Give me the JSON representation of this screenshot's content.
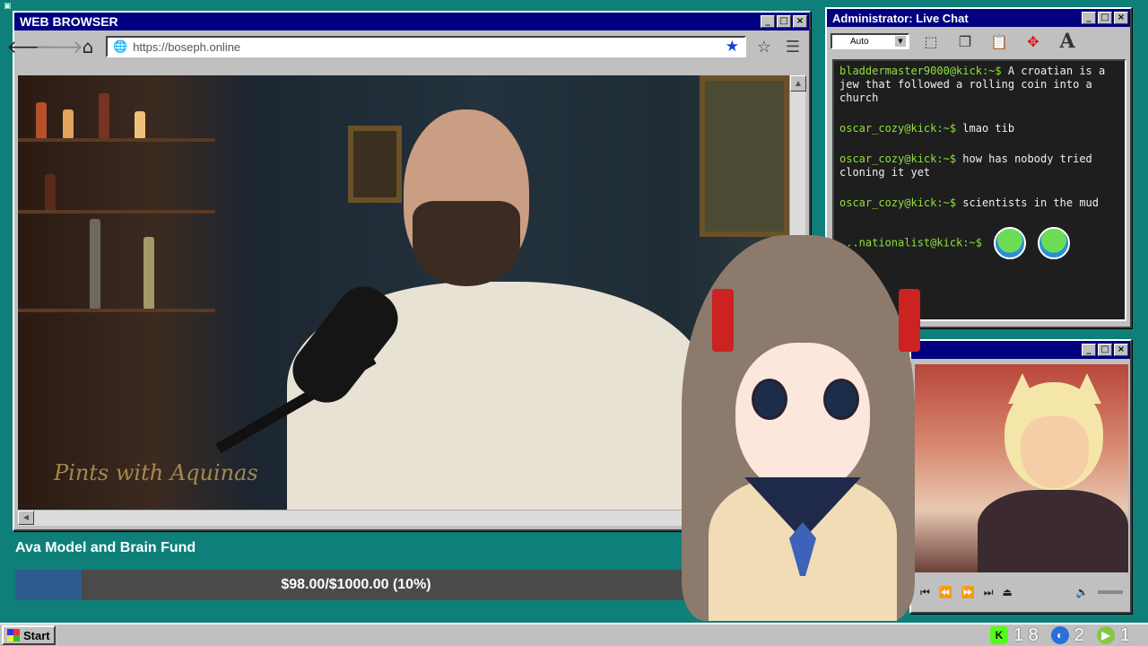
{
  "browser": {
    "title": "WEB BROWSER",
    "url": "https://boseph.online",
    "video_watermark": "Pints with Aquinas"
  },
  "fund": {
    "title": "Ava Model and Brain Fund",
    "progress_text": "$98.00/$1000.00 (10%)",
    "progress_fraction": 0.098,
    "fill_color": "#2d5b8f"
  },
  "chat": {
    "title": "Administrator: Live Chat",
    "font_select": "Auto",
    "messages": [
      {
        "user": "bladdermaster9000@kick:~$",
        "text": "A croatian is a jew that followed a rolling coin into a church"
      },
      {
        "user": "oscar_cozy@kick:~$",
        "text": "lmao tib"
      },
      {
        "user": "oscar_cozy@kick:~$",
        "text": "how has nobody tried cloning it yet"
      },
      {
        "user": "oscar_cozy@kick:~$",
        "text": "scientists in the mud"
      },
      {
        "user": "...nationalist@kick:~$",
        "text": ""
      }
    ]
  },
  "taskbar": {
    "start_label": "Start",
    "tray": [
      {
        "icon": "kick-icon",
        "glyph": "K",
        "count": "1 8"
      },
      {
        "icon": "moon-icon",
        "glyph": "◐",
        "count": "2"
      },
      {
        "icon": "rumble-icon",
        "glyph": "▶",
        "count": "1"
      }
    ]
  },
  "colors": {
    "desktop": "#0f7f7a",
    "titlebar": "#000080",
    "chat_username": "#8fe03c"
  }
}
